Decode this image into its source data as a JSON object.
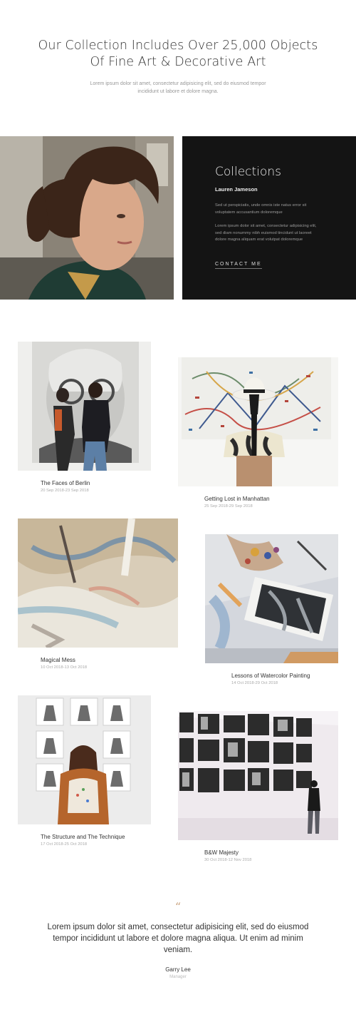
{
  "hero": {
    "title_line1": "Our Collection Includes Over 25,000 Objects",
    "title_line2": "Of Fine Art & Decorative Art",
    "subtitle_line1": "Lorem ipsum dolor sit amet, consectetur adipisicing elit, sed do eiusmod tempor",
    "subtitle_line2": "incididunt ut labore et dolore magna."
  },
  "feature": {
    "title": "Collections",
    "name": "Lauren Jameson",
    "para1": "Sed ut perspiciatis, unde omnis iste natus error sit voluptatem accusantium doloremque",
    "para2": "Lorem ipsum dolor sit amet, consectetur adipisicing elit, sed diam nonummy nibh euismod tincidunt ut laoreet dolore magna aliquam erat volutpat doloremque",
    "cta": "CONTACT ME"
  },
  "exhibitions": [
    {
      "title": "The Faces of Berlin",
      "dates": "20 Sep 2018-23 Sep 2018"
    },
    {
      "title": "Getting Lost in Manhattan",
      "dates": "25 Sep 2018-29 Sep 2018"
    },
    {
      "title": "Magical Mess",
      "dates": "10 Oct 2018-13 Oct 2018"
    },
    {
      "title": "Lessons of Watercolor Painting",
      "dates": "14 Oct 2018-29 Oct 2018"
    },
    {
      "title": "The Structure and The Technique",
      "dates": "17 Oct 2018-25 Oct 2018"
    },
    {
      "title": "B&W Majesty",
      "dates": "30 Oct 2018-12 Nov 2018"
    }
  ],
  "testimonial": {
    "quote_mark": "“",
    "text": "Lorem ipsum dolor sit amet, consectetur adipisicing elit, sed do eiusmod tempor incididunt ut labore et dolore magna aliqua. Ut enim ad minim veniam.",
    "author": "Garry Lee",
    "role": "Manager"
  }
}
